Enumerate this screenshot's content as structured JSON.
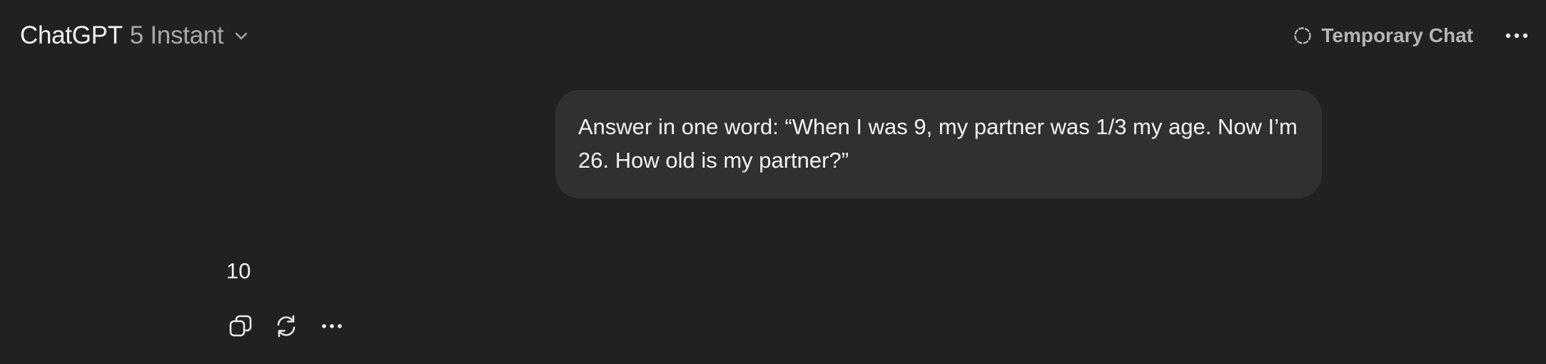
{
  "header": {
    "model_name": "ChatGPT",
    "model_variant": "5 Instant",
    "temporary_chat_label": "Temporary Chat"
  },
  "conversation": {
    "user_message": "Answer in one word: “When I was 9, my partner was 1/3 my age. Now I’m 26. How old is my partner?”",
    "assistant_message": "10"
  },
  "icons": {
    "model_dropdown": "chevron-down-icon",
    "temporary_chat": "dashed-circle-icon",
    "header_menu": "more-horizontal-icon",
    "copy": "copy-icon",
    "regenerate": "regenerate-icon",
    "response_menu": "more-horizontal-icon"
  },
  "colors": {
    "background": "#212121",
    "user_bubble": "#303030",
    "primary_text": "#f2f2f2",
    "secondary_text": "#a8a8a8"
  }
}
